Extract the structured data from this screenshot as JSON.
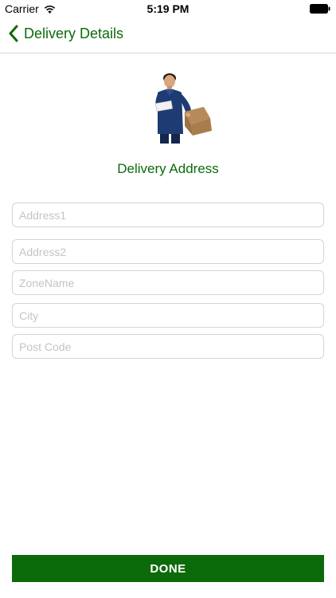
{
  "status_bar": {
    "carrier": "Carrier",
    "time": "5:19 PM",
    "wifi_icon": "wifi-icon",
    "battery_icon": "battery-full-icon"
  },
  "nav": {
    "back_icon": "chevron-left-icon",
    "title": "Delivery Details"
  },
  "illustration": {
    "icon": "delivery-man-with-box-image"
  },
  "section": {
    "heading": "Delivery Address"
  },
  "form": {
    "address1": {
      "placeholder": "Address1",
      "value": ""
    },
    "address2": {
      "placeholder": "Address2",
      "value": ""
    },
    "zone_name": {
      "placeholder": "ZoneName",
      "value": ""
    },
    "city": {
      "placeholder": "City",
      "value": ""
    },
    "post_code": {
      "placeholder": "Post Code",
      "value": ""
    }
  },
  "done_button": {
    "label": "DONE"
  },
  "colors": {
    "accent": "#0b6b0b",
    "field_border": "#d4d4d4",
    "placeholder": "#c4c4c4"
  }
}
